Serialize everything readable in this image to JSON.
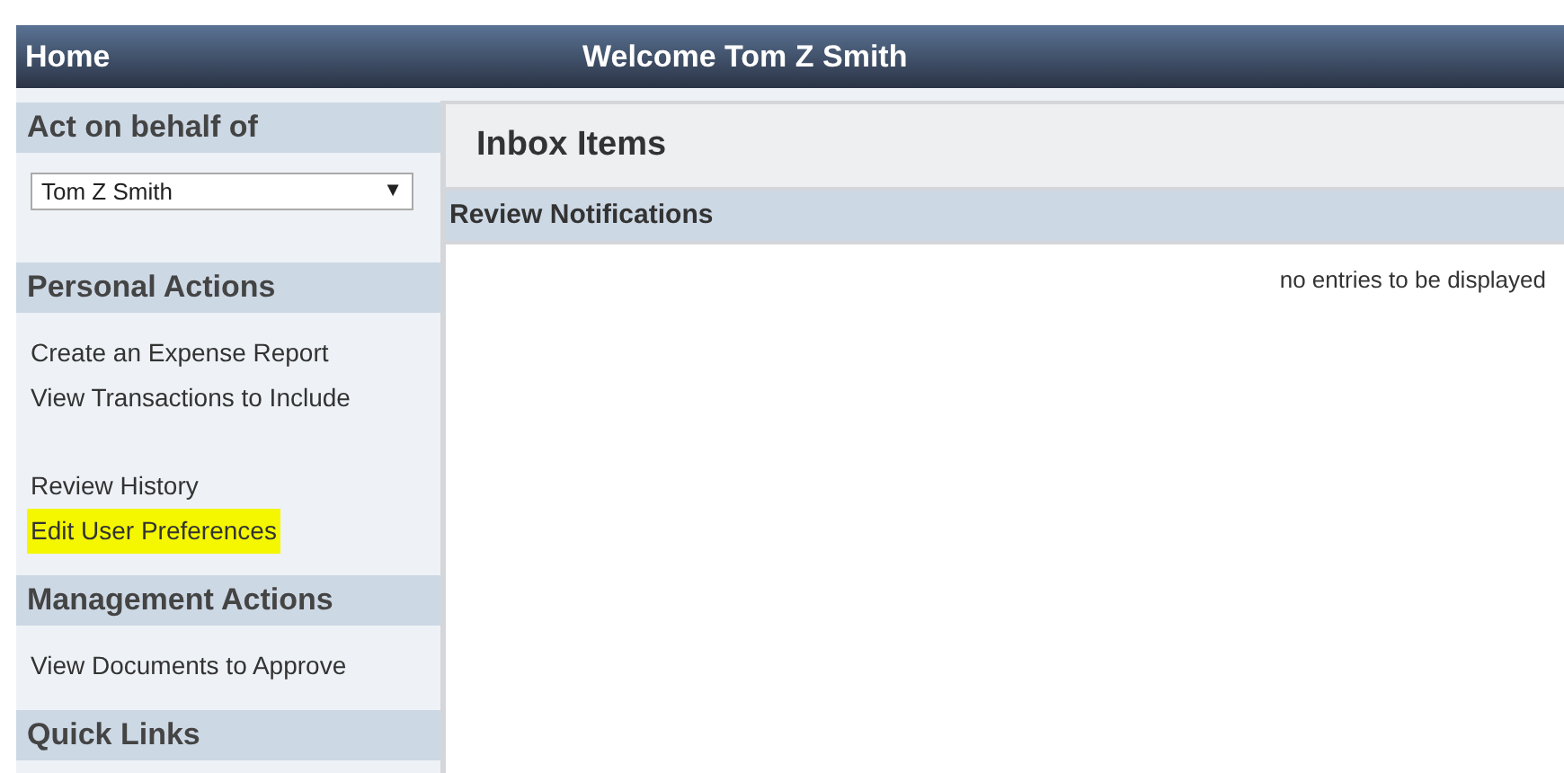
{
  "header": {
    "home": "Home",
    "welcome": "Welcome Tom Z Smith"
  },
  "sidebar": {
    "sections": [
      {
        "title": "Act on behalf of",
        "kind": "select",
        "value": "Tom Z Smith",
        "arrow": "▼"
      },
      {
        "title": "Personal Actions",
        "kind": "links",
        "groups": [
          [
            {
              "label": "Create an Expense Report",
              "highlighted": false
            },
            {
              "label": "View Transactions to Include",
              "highlighted": false
            }
          ],
          [
            {
              "label": "Review History",
              "highlighted": false
            },
            {
              "label": "Edit User Preferences",
              "highlighted": true
            }
          ]
        ]
      },
      {
        "title": "Management Actions",
        "kind": "links",
        "groups": [
          [
            {
              "label": "View Documents to Approve",
              "highlighted": false
            }
          ]
        ]
      },
      {
        "title": "Quick Links",
        "kind": "links"
      }
    ]
  },
  "main": {
    "title": "Inbox Items",
    "panel": {
      "title": "Review Notifications",
      "empty_message": "no entries to be displayed"
    }
  }
}
